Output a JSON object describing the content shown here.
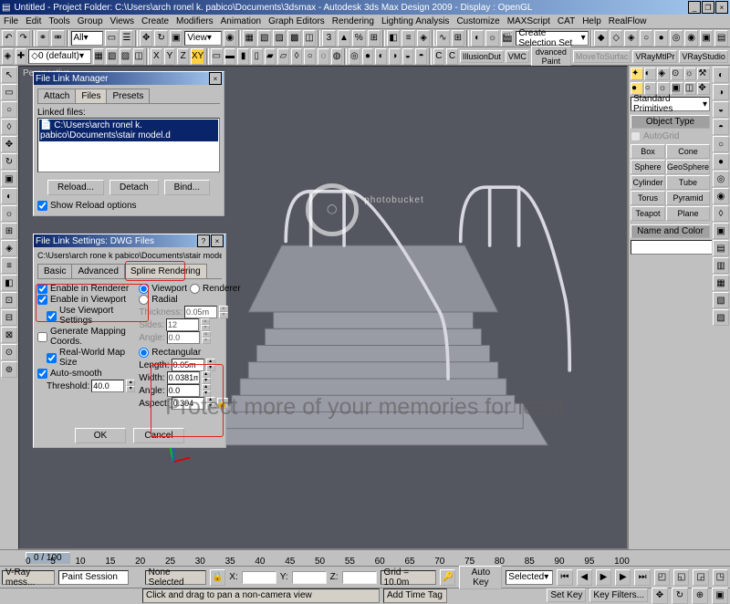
{
  "title": "Untitled  -  Project Folder: C:\\Users\\arch ronel k. pabico\\Documents\\3dsmax  -  Autodesk 3ds Max Design 2009  -  Display : OpenGL",
  "menu": [
    "File",
    "Edit",
    "Tools",
    "Group",
    "Views",
    "Create",
    "Modifiers",
    "Animation",
    "Graph Editors",
    "Rendering",
    "Lighting Analysis",
    "Customize",
    "MAXScript",
    "CAT",
    "Help",
    "RealFlow"
  ],
  "toolbar1": {
    "all_combo": "All",
    "view_combo": "View"
  },
  "toolbar2": {
    "layer_combo": "0 (default)",
    "axes": [
      "X",
      "Y",
      "Z",
      "XY"
    ],
    "create_sel": "Create Selection Set",
    "right_btns": [
      "IllusionDut",
      "VMC",
      "dvanced Paint",
      "MoveToSurfac",
      "VRayMtlPr",
      "VRayStudio"
    ]
  },
  "viewport_label": "Perspective",
  "dlg_flm": {
    "title": "File Link Manager",
    "tabs": [
      "Attach",
      "Files",
      "Presets"
    ],
    "linked_label": "Linked files:",
    "file": "C:\\Users\\arch ronel k. pabico\\Documents\\stair model.d",
    "btn_reload": "Reload...",
    "btn_detach": "Detach",
    "btn_bind": "Bind...",
    "chk_show": "Show Reload options"
  },
  "dlg_fls": {
    "title": "File Link Settings: DWG Files",
    "path": "C:\\Users\\arch rone k  pabico\\Documents\\stair model.dwg",
    "tabs": [
      "Basic",
      "Advanced",
      "Spline Rendering"
    ],
    "chk_ren": "Enable in Renderer",
    "chk_vp": "Enable in Viewport",
    "chk_useVP": "Use Viewport Settings",
    "chk_map": "Generate Mapping Coords.",
    "chk_real": "Real-World Map Size",
    "chk_auto": "Auto-smooth",
    "thresh_lbl": "Threshold:",
    "thresh_val": "40.0",
    "radio_vp": "Viewport",
    "radio_ren": "Renderer",
    "radio_rad": "Radial",
    "rad_thick": "Thickness:",
    "rad_thick_v": "0.05m",
    "rad_sides": "Sides:",
    "rad_sides_v": "12",
    "rad_angle": "Angle:",
    "rad_angle_v": "0.0",
    "radio_rect": "Rectangular",
    "rect_len": "Length:",
    "rect_len_v": "0.05m",
    "rect_wid": "Width:",
    "rect_wid_v": "0.0381m",
    "rect_ang": "Angle:",
    "rect_ang_v": "0.0",
    "rect_asp": "Aspect:",
    "rect_asp_v": "0.304",
    "btn_ok": "OK",
    "btn_cancel": "Cancel"
  },
  "cmdpanel": {
    "combo": "Standard Primitives",
    "rollout1": "Object Type",
    "autogrid": "AutoGrid",
    "btns": [
      "Box",
      "Cone",
      "Sphere",
      "GeoSphere",
      "Cylinder",
      "Tube",
      "Torus",
      "Pyramid",
      "Teapot",
      "Plane"
    ],
    "rollout2": "Name and Color"
  },
  "timeline": {
    "range": "0 / 100",
    "ticks": [
      "0",
      "5",
      "10",
      "15",
      "20",
      "25",
      "30",
      "35",
      "40",
      "45",
      "50",
      "55",
      "60",
      "65",
      "70",
      "75",
      "80",
      "85",
      "90",
      "95",
      "100"
    ]
  },
  "status": {
    "left1": "V-Ray mess...",
    "left2": "Paint Session",
    "none": "None Selected",
    "hint": "Click and drag to pan a non-camera view",
    "x": "X:",
    "y": "Y:",
    "z": "Z:",
    "grid": "Grid = 10.0m",
    "autokey": "Auto Key",
    "setkey": "Set Key",
    "sel_combo": "Selected",
    "kf": "Key Filters...",
    "att": "Add Time Tag"
  },
  "watermark1": "photobucket",
  "watermark2": "Protect more of your memories for less!"
}
